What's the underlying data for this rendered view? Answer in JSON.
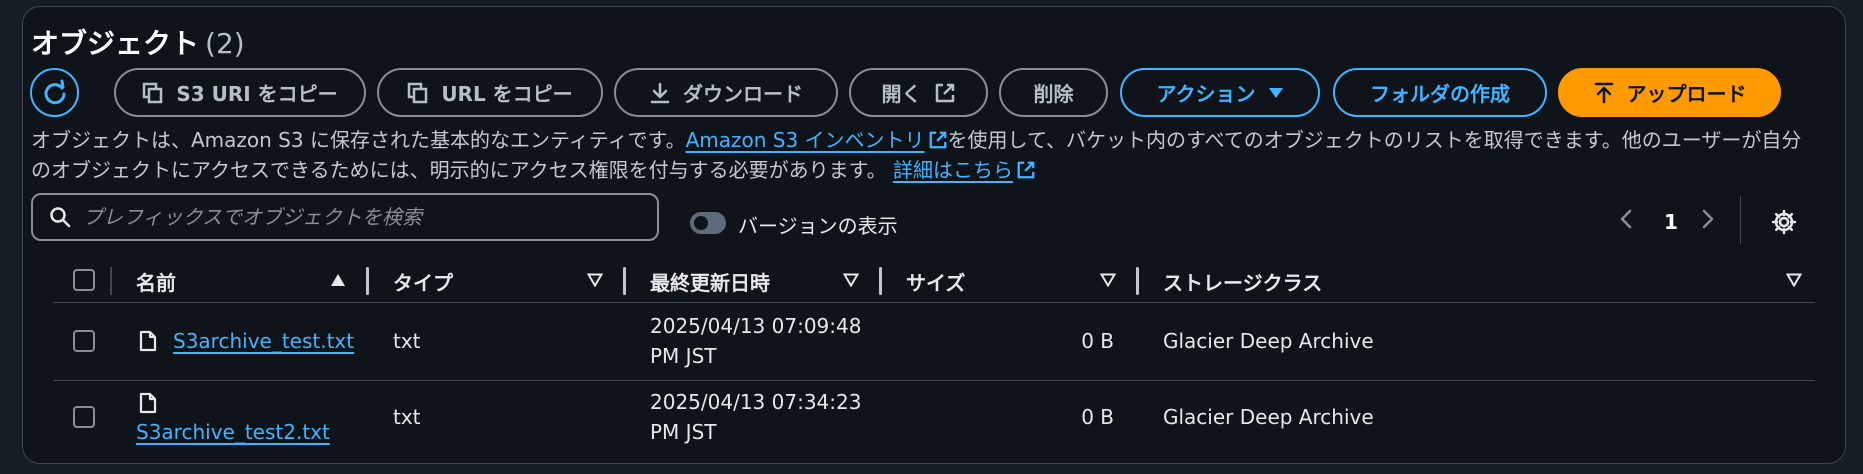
{
  "header": {
    "title": "オブジェクト",
    "count": "(2)"
  },
  "toolbar": {
    "copy_s3_uri": "S3 URI をコピー",
    "copy_url": "URL をコピー",
    "download": "ダウンロード",
    "open": "開く",
    "delete": "削除",
    "actions": "アクション",
    "create_folder": "フォルダの作成",
    "upload": "アップロード"
  },
  "description": {
    "part1": "オブジェクトは、Amazon S3 に保存された基本的なエンティティです。",
    "inventory_link": "Amazon S3 インベントリ",
    "part2": "を使用して、バケット内のすべてのオブジェクトのリストを取得できます。他のユーザーが自分のオブジェクトにアクセスできるためには、明示的にアクセス権限を付与する必要があります。",
    "details_link": "詳細はこちら"
  },
  "search": {
    "placeholder": "プレフィックスでオブジェクトを検索"
  },
  "versions_toggle": {
    "label": "バージョンの表示"
  },
  "pagination": {
    "page": "1"
  },
  "table": {
    "columns": [
      "名前",
      "タイプ",
      "最終更新日時",
      "サイズ",
      "ストレージクラス"
    ],
    "rows": [
      {
        "name": "S3archive_test.txt",
        "type": "txt",
        "modified_line1": "2025/04/13 07:09:48",
        "modified_line2": "PM JST",
        "size": "0 B",
        "storage_class": "Glacier Deep Archive"
      },
      {
        "name": "S3archive_test2.txt",
        "type": "txt",
        "modified_line1": "2025/04/13 07:34:23",
        "modified_line2": "PM JST",
        "size": "0 B",
        "storage_class": "Glacier Deep Archive"
      }
    ]
  },
  "colors": {
    "background": "#0f141a",
    "accent": "#42b4ff",
    "primary_button": "#ff9900",
    "border": "#8c8c94"
  },
  "icons": [
    "refresh-icon",
    "copy-icon",
    "download-icon",
    "external-link-icon",
    "caret-down-icon",
    "upload-icon",
    "search-icon",
    "chevron-left-icon",
    "chevron-right-icon",
    "gear-icon",
    "sort-ascending-icon",
    "sort-icon",
    "file-icon"
  ]
}
